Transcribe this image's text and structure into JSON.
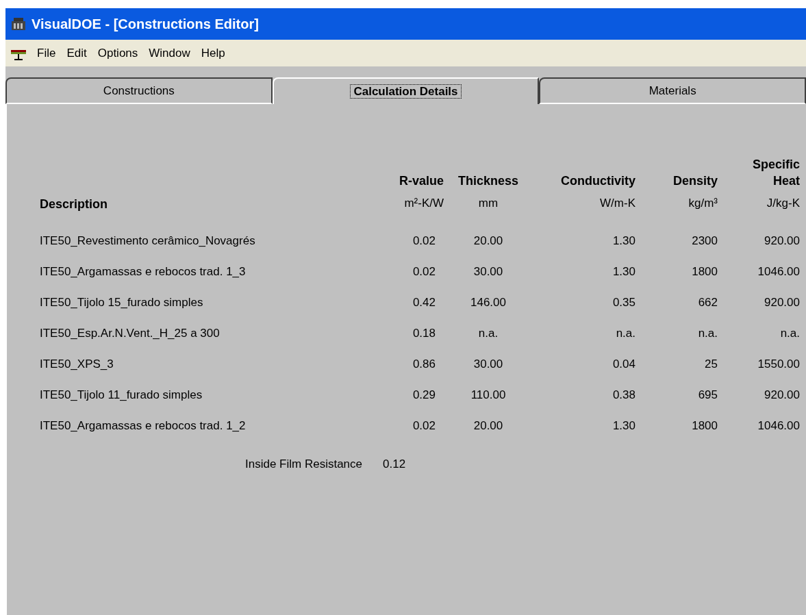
{
  "window": {
    "title": "VisualDOE - [Constructions Editor]"
  },
  "menu": [
    "File",
    "Edit",
    "Options",
    "Window",
    "Help"
  ],
  "tabs": [
    {
      "label": "Constructions",
      "selected": false
    },
    {
      "label": "Calculation Details",
      "selected": true
    },
    {
      "label": "Materials",
      "selected": false
    }
  ],
  "table": {
    "columns": [
      {
        "name": "Description"
      },
      {
        "name": "R-value",
        "unit": "m²-K/W"
      },
      {
        "name": "Thickness",
        "unit": "mm"
      },
      {
        "name": "Conductivity",
        "unit": "W/m-K"
      },
      {
        "name": "Density",
        "unit": "kg/m³"
      },
      {
        "name": "Specific Heat",
        "unit": "J/kg-K"
      }
    ],
    "rows": [
      [
        "ITE50_Revestimento cerâmico_Novagrés",
        "0.02",
        "20.00",
        "1.30",
        "2300",
        "920.00"
      ],
      [
        "ITE50_Argamassas e rebocos trad. 1_3",
        "0.02",
        "30.00",
        "1.30",
        "1800",
        "1046.00"
      ],
      [
        "ITE50_Tijolo 15_furado simples",
        "0.42",
        "146.00",
        "0.35",
        "662",
        "920.00"
      ],
      [
        "ITE50_Esp.Ar.N.Vent._H_25 a 300",
        "0.18",
        "n.a.",
        "n.a.",
        "n.a.",
        "n.a."
      ],
      [
        "ITE50_XPS_3",
        "0.86",
        "30.00",
        "0.04",
        "25",
        "1550.00"
      ],
      [
        "ITE50_Tijolo 11_furado simples",
        "0.29",
        "110.00",
        "0.38",
        "695",
        "920.00"
      ],
      [
        "ITE50_Argamassas e rebocos trad. 1_2",
        "0.02",
        "20.00",
        "1.30",
        "1800",
        "1046.00"
      ]
    ]
  },
  "inside_film": {
    "label": "Inside Film Resistance",
    "value": "0.12"
  }
}
